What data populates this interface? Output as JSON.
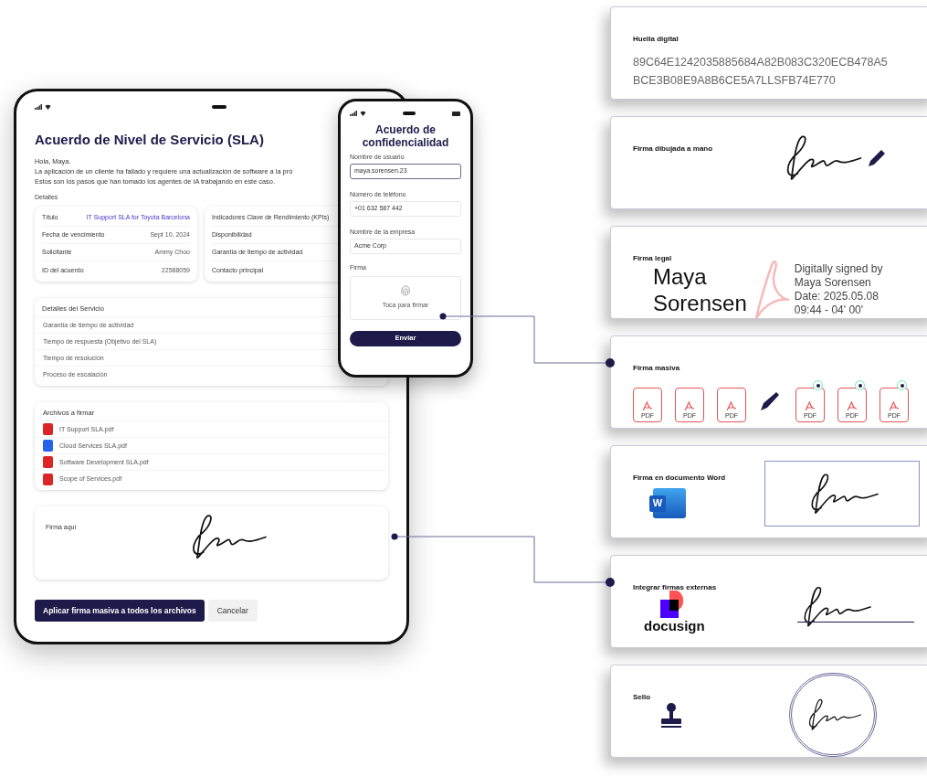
{
  "tablet": {
    "title": "Acuerdo de Nivel de Servicio (SLA)",
    "message_lines": [
      "Hola, Maya.",
      "La aplicación de un cliente ha fallado y requiere una actualización de software a la pró",
      "Estos son los pasos que han tomado los agentes de IA trabajando en este caso."
    ],
    "details_label": "Detalles",
    "details_left": [
      {
        "label": "Título",
        "value": "IT Support SLA for Toyota Barcelona",
        "link": true
      },
      {
        "label": "Fecha de vencimiento",
        "value": "Sept 10, 2024",
        "link": false
      },
      {
        "label": "Solicitante",
        "value": "Ammy Choo",
        "link": false
      },
      {
        "label": "ID del acuerdo",
        "value": "22588059",
        "link": false
      }
    ],
    "details_right": [
      "Indicadores Clave de Rendimiento (KPIs)",
      "Disponibilidad",
      "Garantía de tiempo de actividad",
      "Contacto principal"
    ],
    "service": {
      "title": "Detalles del Servicio",
      "rows": [
        "Garantía de tiempo de actividad",
        "Tiempo de respuesta (Objetivo del SLA)",
        "Tiempo de resolución",
        "Proceso de escalación"
      ]
    },
    "files": {
      "title": "Archivos a firmar",
      "items": [
        {
          "name": "IT Support SLA.pdf",
          "kind": "pdf"
        },
        {
          "name": "Cloud Services SLA.pdf",
          "kind": "doc"
        },
        {
          "name": "Software Development SLA.pdf",
          "kind": "pdf"
        },
        {
          "name": "Scope of Services.pdf",
          "kind": "pdf"
        }
      ]
    },
    "signature_label": "Firma aquí",
    "primary_button": "Aplicar firma masiva a todos los archivos",
    "secondary_button": "Cancelar"
  },
  "phone": {
    "title": "Acuerdo de confidencialidad",
    "fields": [
      {
        "label": "Nombre de usuario",
        "value": "maya.sorensen.23",
        "focused": true
      },
      {
        "label": "Número de teléfono",
        "value": "+01 632 587 442",
        "focused": false
      },
      {
        "label": "Nombre de la empresa",
        "value": "Acme Corp",
        "focused": false
      }
    ],
    "signature_label": "Firma",
    "signature_hint": "Toca para firmar",
    "submit": "Enviar"
  },
  "features": [
    {
      "kind": "hash",
      "title": "Huella digital",
      "lines": [
        "89C64E1242035885684A82B083C320ECB478A5",
        "BCE3B08E9A8B6CE5A7LLSFB74E770"
      ]
    },
    {
      "kind": "handwritten",
      "title": "Firma dibujada a mano"
    },
    {
      "kind": "legal",
      "title": "Firma legal",
      "name_lines": [
        "Maya",
        "Sorensen"
      ],
      "info_lines": [
        "Digitally signed by",
        "Maya Sorensen",
        "Date: 2025.05.08",
        "09:44 - 04' 00'"
      ]
    },
    {
      "kind": "bulk",
      "title": "Firma masiva",
      "files": [
        {
          "label": "PDF",
          "signed": false
        },
        {
          "label": "PDF",
          "signed": false
        },
        {
          "label": "PDF",
          "signed": false
        },
        {
          "label": "PDF",
          "signed": true
        },
        {
          "label": "PDF",
          "signed": true
        },
        {
          "label": "PDF",
          "signed": true
        }
      ]
    },
    {
      "kind": "word",
      "title": "Firma en documento Word",
      "letter": "W"
    },
    {
      "kind": "external",
      "title": "Integrar firmas externas",
      "logo_text": "docusign"
    },
    {
      "kind": "stamp",
      "title": "Sello"
    }
  ]
}
